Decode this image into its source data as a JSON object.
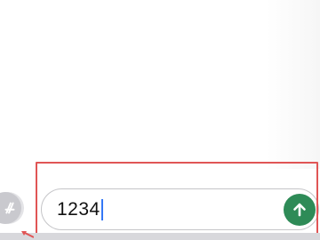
{
  "composer": {
    "message_text": "1234",
    "send_icon": "arrow-up-icon",
    "appstore_icon": "app-store-icon"
  },
  "colors": {
    "send_button": "#2e8b57",
    "highlight": "#e05555",
    "caret": "#3478f6"
  }
}
